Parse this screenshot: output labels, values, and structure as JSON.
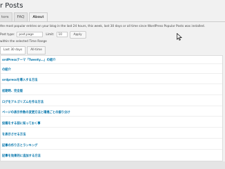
{
  "page": {
    "title": "r Posts"
  },
  "tabs": [
    {
      "label": "tors"
    },
    {
      "label": "FAQ"
    },
    {
      "label": "About"
    }
  ],
  "intro": "the most popular entries on your blog in the last 24 hours, this week, last 30 days or all time since WordPress Popular Posts was installed.",
  "filter": {
    "post_type_label": "Post type:",
    "post_type_value": "post,page",
    "limit_label": "Limit:",
    "limit_value": "10",
    "apply_label": "Apply"
  },
  "time_note": "within the selected Time Range",
  "range_buttons": [
    {
      "label": "Last 30 days"
    },
    {
      "label": "All-time"
    }
  ],
  "posts": [
    "ordPressテーマ「Twenty...」の紹介",
    "の紹介",
    "ordpressを導入する方法",
    "初期時、完全版",
    "ログをアルゴリズムを作る方法",
    "ページの表示件数の変更方法と環境ごとの振り分け",
    "投稿をする前に知っておく事",
    "を表示させる方法",
    "記事の作り方とランキング",
    "記事を効果的に追加する方法"
  ]
}
